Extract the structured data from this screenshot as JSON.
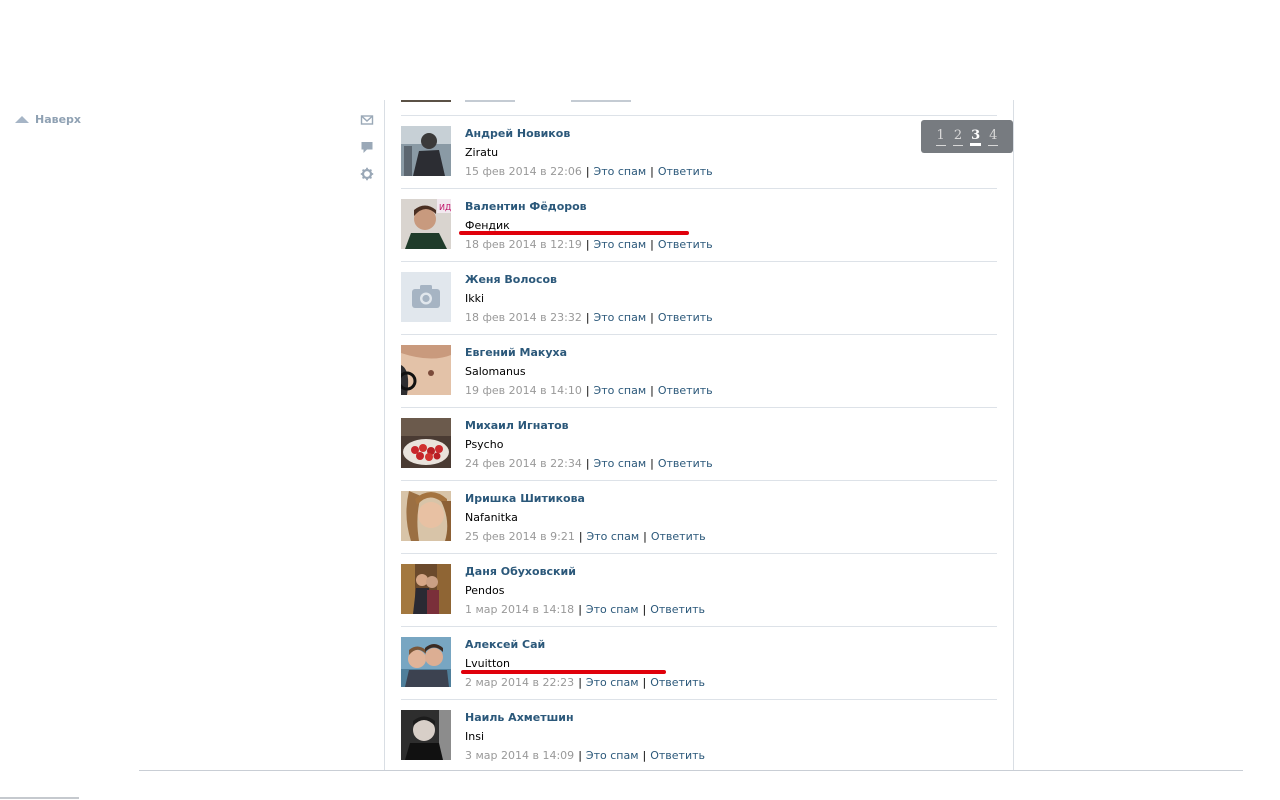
{
  "nav": {
    "to_top_label": "Наверх"
  },
  "side_icons": [
    "envelope-icon",
    "comment-icon",
    "gear-icon"
  ],
  "pager": {
    "pages": [
      "1",
      "2",
      "3",
      "4"
    ],
    "current": "3"
  },
  "comments": [
    {
      "name": "Андрей Новиков",
      "text": "Ziratu",
      "date": "15 фев 2014 в 22:06",
      "spam": "Это спам",
      "reply": "Ответить",
      "avatar": "photo-dark-figure"
    },
    {
      "name": "Валентин Фёдоров",
      "text": "Фендик",
      "date": "18 фев 2014 в 12:19",
      "spam": "Это спам",
      "reply": "Ответить",
      "avatar": "photo-young-man"
    },
    {
      "name": "Женя Волосов",
      "text": "Ikki",
      "date": "18 фев 2014 в 23:32",
      "spam": "Это спам",
      "reply": "Ответить",
      "avatar": "camera-placeholder-icon"
    },
    {
      "name": "Евгений Макуха",
      "text": "Salomanus",
      "date": "19 фев 2014 в 14:10",
      "spam": "Это спам",
      "reply": "Ответить",
      "avatar": "photo-face-closeup"
    },
    {
      "name": "Михаил Игнатов",
      "text": "Psycho",
      "date": "24 фев 2014 в 22:34",
      "spam": "Это спам",
      "reply": "Ответить",
      "avatar": "photo-strawberries"
    },
    {
      "name": "Иришка Шитикова",
      "text": "Nafanitka",
      "date": "25 фев 2014 в 9:21",
      "spam": "Это спам",
      "reply": "Ответить",
      "avatar": "photo-girl"
    },
    {
      "name": "Даня Обуховский",
      "text": "Pendos",
      "date": "1 мар 2014 в 14:18",
      "spam": "Это спам",
      "reply": "Ответить",
      "avatar": "photo-couple"
    },
    {
      "name": "Алексей Сай",
      "text": "Lvuitton",
      "date": "2 мар 2014 в 22:23",
      "spam": "Это спам",
      "reply": "Ответить",
      "avatar": "photo-two-people-sea"
    },
    {
      "name": "Наиль Ахметшин",
      "text": "Insi",
      "date": "3 мар 2014 в 14:09",
      "spam": "Это спам",
      "reply": "Ответить",
      "avatar": "photo-man-dark"
    }
  ],
  "colors": {
    "link": "#2b587a",
    "meta": "#999999",
    "highlight": "#e0000b",
    "pager_bg": "#777b80"
  }
}
